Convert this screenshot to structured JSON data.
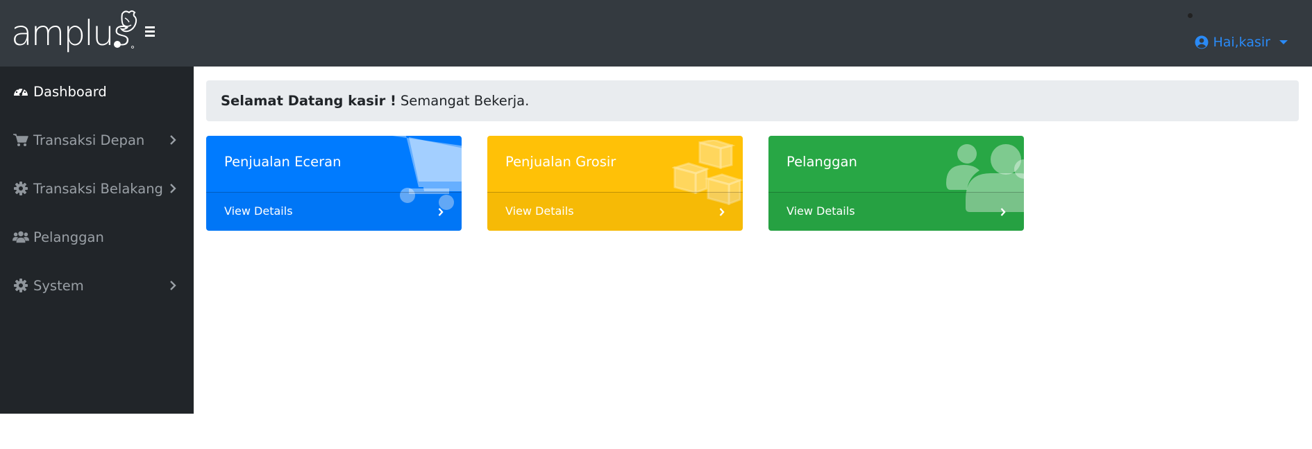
{
  "brand": {
    "name": "amplus"
  },
  "header": {
    "user_label": "Hai,kasir",
    "icons": {
      "menu": "hamburger-icon",
      "user": "user-circle-icon",
      "caret": "caret-down-icon"
    }
  },
  "sidebar": {
    "items": [
      {
        "label": "Dashboard",
        "icon": "tachometer-icon",
        "active": true,
        "has_submenu": false
      },
      {
        "label": "Transaksi Depan",
        "icon": "shopping-cart-icon",
        "active": false,
        "has_submenu": true
      },
      {
        "label": "Transaksi Belakang",
        "icon": "gear-icon",
        "active": false,
        "has_submenu": true
      },
      {
        "label": "Pelanggan",
        "icon": "users-icon",
        "active": false,
        "has_submenu": false
      },
      {
        "label": "System",
        "icon": "gear-icon",
        "active": false,
        "has_submenu": true
      }
    ]
  },
  "welcome": {
    "bold": "Selamat Datang kasir !",
    "text": "Semangat Bekerja."
  },
  "cards": [
    {
      "title": "Penjualan Eceran",
      "footer": "View Details",
      "color": "#007bff",
      "icon": "shopping-cart-icon"
    },
    {
      "title": "Penjualan Grosir",
      "footer": "View Details",
      "color": "#ffc107",
      "icon": "cubes-icon"
    },
    {
      "title": "Pelanggan",
      "footer": "View Details",
      "color": "#28a745",
      "icon": "users-icon"
    }
  ],
  "colors": {
    "topbar": "#343a40",
    "sidebar": "#212529",
    "accent": "#2a8af6",
    "welcome_bg": "#e9ecef"
  }
}
